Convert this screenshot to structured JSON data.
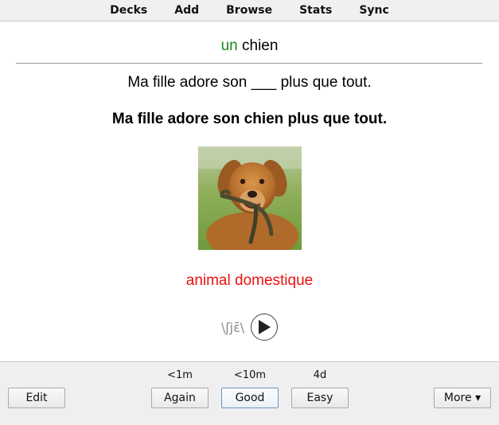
{
  "toolbar": {
    "items": [
      {
        "label": "Decks"
      },
      {
        "label": "Add"
      },
      {
        "label": "Browse"
      },
      {
        "label": "Stats"
      },
      {
        "label": "Sync"
      }
    ]
  },
  "card": {
    "article": "un",
    "word": "chien",
    "cloze_sentence": "Ma fille adore son ___ plus que tout.",
    "answer_sentence": "Ma fille adore son chien plus que tout.",
    "image_subject": "golden retriever holding a leash",
    "category": "animal domestique",
    "pronunciation": "\\ʃjɛ̃\\",
    "play_icon": "play-icon"
  },
  "answer_bar": {
    "edit_label": "Edit",
    "more_label": "More ▾",
    "buttons": [
      {
        "label": "Again",
        "interval": "<1m"
      },
      {
        "label": "Good",
        "interval": "<10m"
      },
      {
        "label": "Easy",
        "interval": "4d"
      }
    ]
  },
  "colors": {
    "article": "#1a8a1a",
    "category": "#e8130f",
    "focus_border": "#6f95c4"
  }
}
